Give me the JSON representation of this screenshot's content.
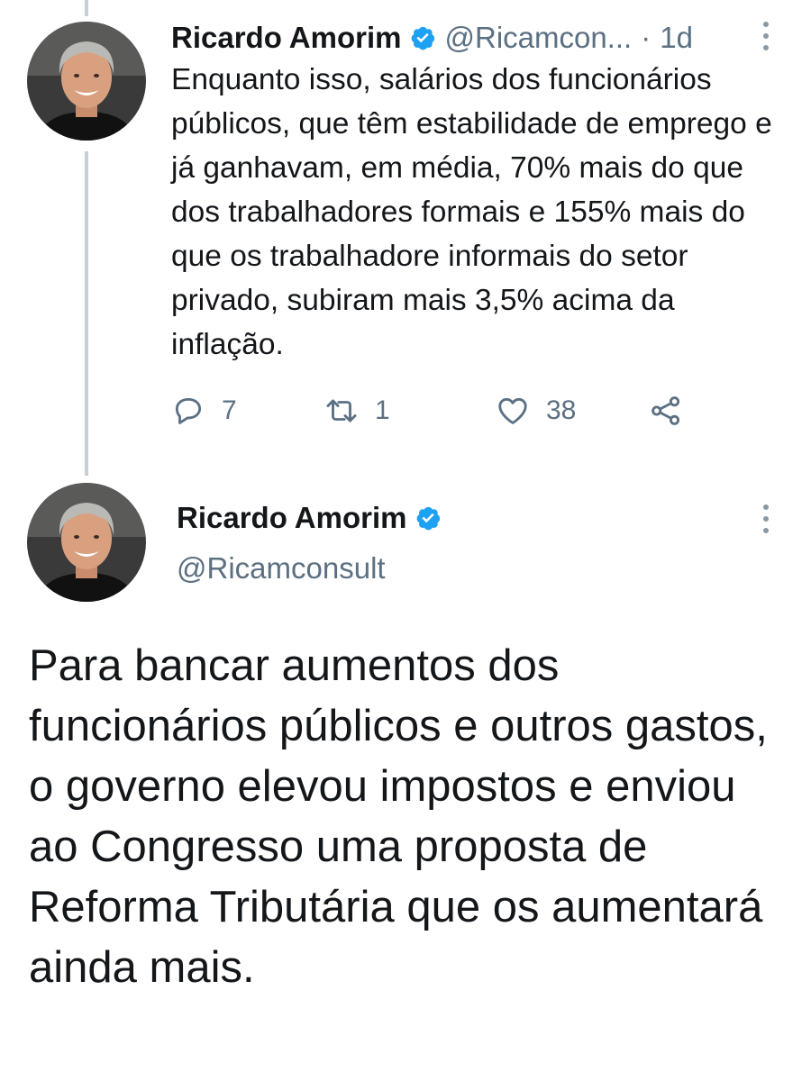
{
  "thread": {
    "tweet1": {
      "author_name": "Ricardo Amorim",
      "handle": "@Ricamcon...",
      "separator": "·",
      "time": "1d",
      "text": "Enquanto isso, salários dos funcionários públicos, que têm estabilidade de emprego e já ganhavam, em média, 70% mais do que dos trabalhadores formais e 155% mais do que os trabalhadore informais do setor privado, subiram mais 3,5% acima da inflação.",
      "replies": "7",
      "retweets": "1",
      "likes": "38"
    },
    "tweet2": {
      "author_name": "Ricardo Amorim",
      "handle": "@Ricamconsult",
      "text": "Para bancar aumentos dos funcionários públicos e outros gastos, o governo elevou impostos e enviou ao Congresso uma proposta de Reforma Tributária que os aumentará ainda mais."
    }
  },
  "icons": {
    "verified": "verified-badge-icon",
    "more": "more-vertical-icon",
    "reply": "reply-icon",
    "retweet": "retweet-icon",
    "like": "heart-icon",
    "share": "share-icon"
  },
  "colors": {
    "verified": "#1da1f2",
    "secondary_text": "#5b7083",
    "thread_line": "#c4cfd6",
    "text": "#14171a"
  }
}
